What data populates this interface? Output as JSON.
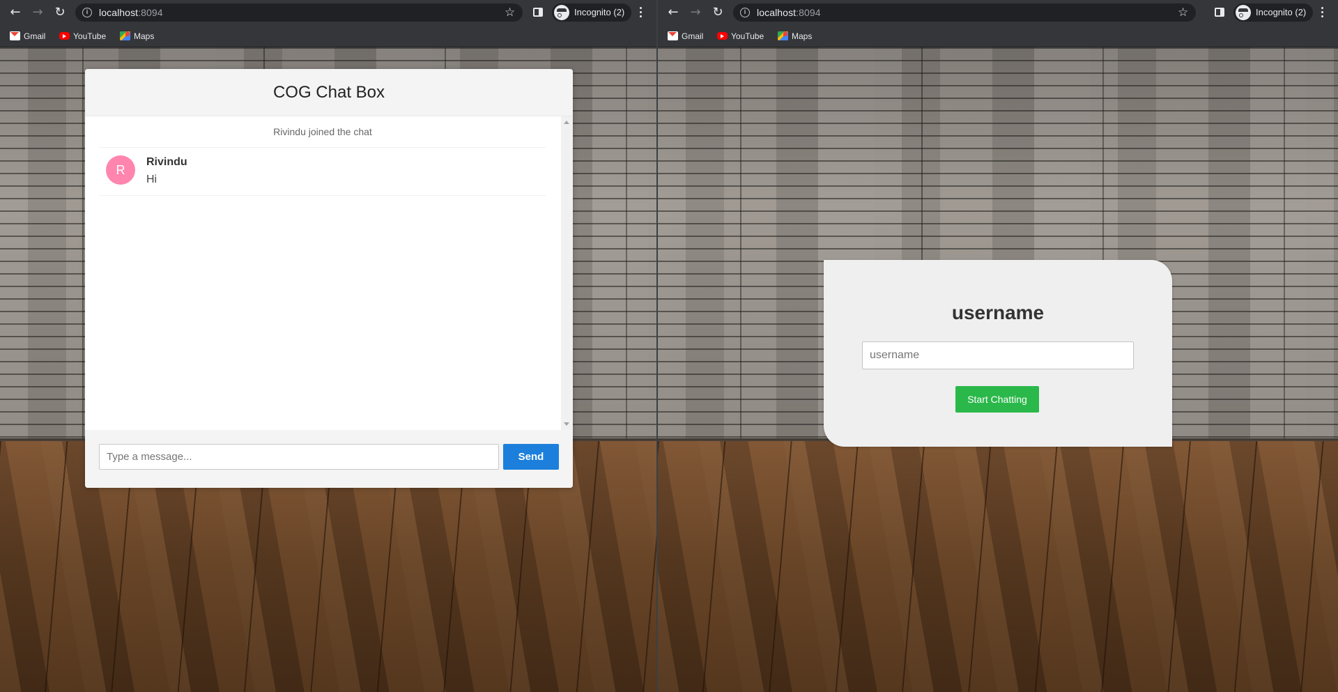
{
  "browser": {
    "url_host": "localhost",
    "url_port": ":8094",
    "incognito_label": "Incognito (2)",
    "bookmarks": [
      "Gmail",
      "YouTube",
      "Maps"
    ]
  },
  "chat": {
    "title": "COG Chat Box",
    "event_text": "Rivindu joined the chat",
    "messages": [
      {
        "avatar_letter": "R",
        "avatar_color": "#ff85af",
        "sender": "Rivindu",
        "text": "Hi"
      }
    ],
    "input_placeholder": "Type a message...",
    "send_label": "Send"
  },
  "login": {
    "title": "username",
    "input_placeholder": "username",
    "button_label": "Start Chatting"
  },
  "colors": {
    "send_button": "#1c7fdb",
    "start_button": "#2bb84a",
    "avatar": "#ff85af"
  }
}
